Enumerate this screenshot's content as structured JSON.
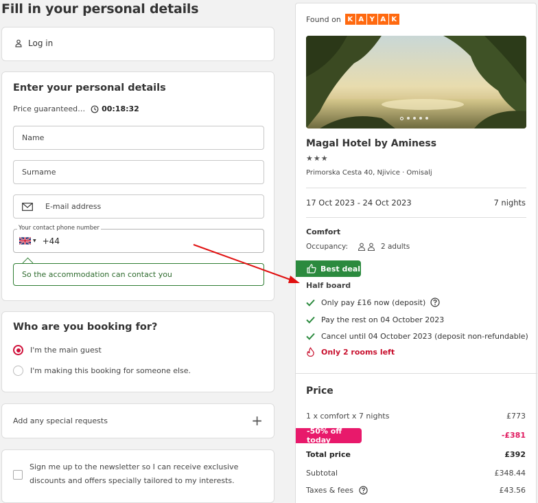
{
  "page_title": "Fill in your personal details",
  "login": {
    "label": "Log in"
  },
  "details": {
    "heading": "Enter your personal details",
    "price_guaranteed": "Price guaranteed…",
    "timer": "00:18:32",
    "name_placeholder": "Name",
    "surname_placeholder": "Surname",
    "email_placeholder": "E-mail address",
    "phone_label": "Your contact phone number",
    "phone_prefix": "+44",
    "phone_hint": "So the accommodation can contact you"
  },
  "who": {
    "heading": "Who are you booking for?",
    "option_main": "I'm the main guest",
    "option_else": "I'm making this booking for someone else."
  },
  "requests": {
    "label": "Add any special requests"
  },
  "newsletter": {
    "text": "Sign me up to the newsletter so I can receive exclusive discounts and offers specially tailored to my interests."
  },
  "summary": {
    "found_on": "Found on",
    "kayak_letters": [
      "K",
      "A",
      "Y",
      "A",
      "K"
    ],
    "hotel_name": "Magal Hotel by Aminess",
    "stars": "★★★",
    "address": "Primorska Cesta 40, Njivice · Omisalj",
    "dates": "17 Oct 2023 - 24 Oct 2023",
    "nights": "7 nights",
    "room_type": "Comfort",
    "occupancy_label": "Occupancy:",
    "occupancy_value": "2 adults",
    "best_deal": "Best deal",
    "board": "Half board",
    "feature_deposit": "Only pay £16 now (deposit)",
    "feature_rest": "Pay the rest on 04 October 2023",
    "feature_cancel": "Cancel until 04 October 2023 (deposit non-refundable)",
    "rooms_left": "Only 2 rooms left"
  },
  "price": {
    "heading": "Price",
    "line_label": "1 x comfort x 7 nights",
    "line_value": "£773",
    "discount_label": "-50% off today",
    "discount_value": "-£381",
    "total_label": "Total price",
    "total_value": "£392",
    "subtotal_label": "Subtotal",
    "subtotal_value": "£348.44",
    "taxes_label": "Taxes & fees",
    "taxes_value": "£43.56"
  },
  "colors": {
    "accent_red": "#d0103a",
    "kayak_orange": "#ff690f",
    "best_deal_green": "#2b8a3e",
    "discount_pink": "#e8196b"
  }
}
